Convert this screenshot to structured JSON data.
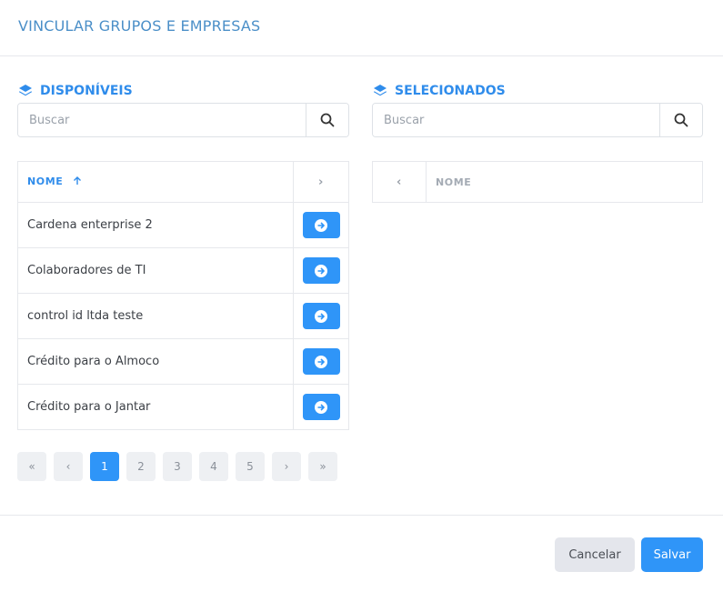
{
  "dialog": {
    "title": "VINCULAR GRUPOS E EMPRESAS"
  },
  "available": {
    "title": "DISPONÍVEIS",
    "icon": "layers-icon",
    "search_placeholder": "Buscar",
    "column_name": "NOME",
    "rows": [
      {
        "name": "Cardena enterprise 2"
      },
      {
        "name": "Colaboradores de TI"
      },
      {
        "name": "control id ltda teste"
      },
      {
        "name": "Crédito para o Almoco"
      },
      {
        "name": "Crédito para o Jantar"
      }
    ]
  },
  "selected": {
    "title": "SELECIONADOS",
    "icon": "layers-icon",
    "search_placeholder": "Buscar",
    "column_name": "NOME"
  },
  "pagination": {
    "first": "«",
    "prev": "‹",
    "pages": [
      "1",
      "2",
      "3",
      "4",
      "5"
    ],
    "active_page": "1",
    "next": "›",
    "last": "»"
  },
  "footer": {
    "cancel_label": "Cancelar",
    "save_label": "Salvar"
  },
  "colors": {
    "accent": "#2f95f8",
    "title": "#4b8fc8",
    "muted": "#eef0f3"
  }
}
